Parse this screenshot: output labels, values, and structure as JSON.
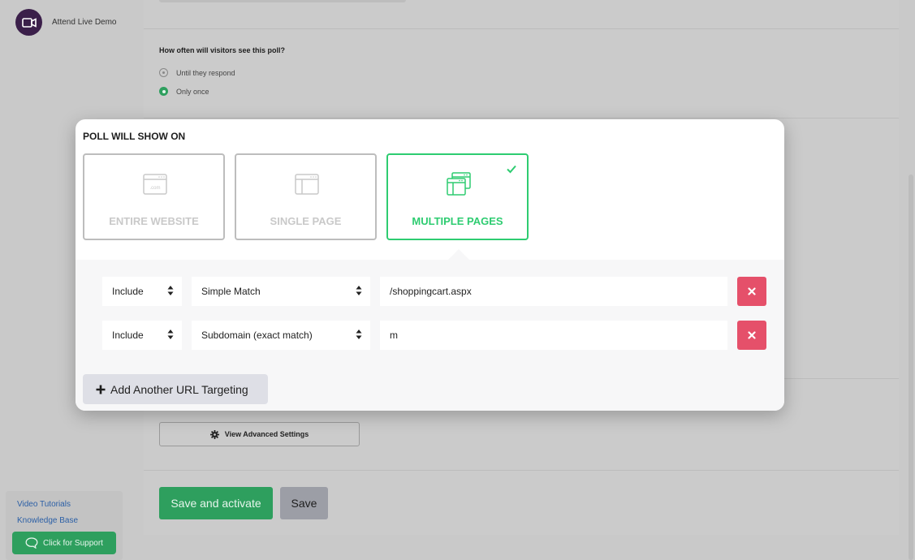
{
  "sidebar": {
    "demo_label": "Attend Live Demo",
    "links": [
      "Video Tutorials",
      "Knowledge Base"
    ],
    "support_label": "Click for Support"
  },
  "frequency": {
    "question": "How often will visitors see this poll?",
    "options": [
      {
        "label": "Until they respond",
        "selected": false
      },
      {
        "label": "Only once",
        "selected": true
      }
    ]
  },
  "advanced": {
    "label": "View Advanced Settings"
  },
  "footer": {
    "activate_label": "Save and activate",
    "save_label": "Save"
  },
  "modal": {
    "title": "POLL WILL SHOW ON",
    "options": [
      {
        "label": "ENTIRE WEBSITE",
        "icon": "website-icon",
        "icon_text": ".com",
        "selected": false
      },
      {
        "label": "SINGLE PAGE",
        "icon": "single-page-icon",
        "selected": false
      },
      {
        "label": "MULTIPLE PAGES",
        "icon": "multiple-pages-icon",
        "selected": true
      }
    ],
    "rules": [
      {
        "mode": "Include",
        "match": "Simple Match",
        "value": "/shoppingcart.aspx"
      },
      {
        "mode": "Include",
        "match": "Subdomain (exact match)",
        "value": "m"
      }
    ],
    "add_label": "Add Another URL Targeting"
  },
  "colors": {
    "accent": "#2ecc71",
    "brand_green": "#2e9f5e",
    "danger": "#e5506a",
    "demo_avatar": "#3b1f4a"
  }
}
